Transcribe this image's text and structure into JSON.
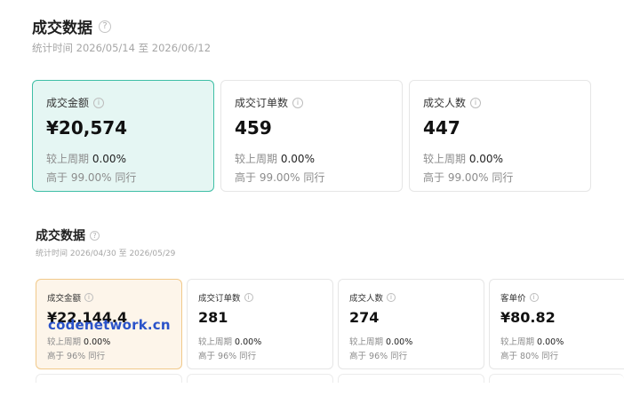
{
  "section1": {
    "title": "成交数据",
    "help_icon": "?",
    "subtitle": "统计时间 2026/05/14 至 2026/06/12",
    "cards": [
      {
        "label": "成交金额",
        "value": "¥20,574",
        "compare_label": "较上周期",
        "compare_value": "0.00%",
        "peer_text": "高于 99.00% 同行",
        "active": true
      },
      {
        "label": "成交订单数",
        "value": "459",
        "compare_label": "较上周期",
        "compare_value": "0.00%",
        "peer_text": "高于 99.00% 同行",
        "active": false
      },
      {
        "label": "成交人数",
        "value": "447",
        "compare_label": "较上周期",
        "compare_value": "0.00%",
        "peer_text": "高于 99.00% 同行",
        "active": false
      }
    ]
  },
  "section2": {
    "title": "成交数据",
    "help_icon": "?",
    "subtitle": "统计时间 2026/04/30 至 2026/05/29",
    "cards": [
      {
        "label": "成交金额",
        "value": "¥22,144.4",
        "compare_label": "较上周期",
        "compare_value": "0.00%",
        "peer_text": "高于 96% 同行",
        "active": true
      },
      {
        "label": "成交订单数",
        "value": "281",
        "compare_label": "较上周期",
        "compare_value": "0.00%",
        "peer_text": "高于 96% 同行",
        "active": false
      },
      {
        "label": "成交人数",
        "value": "274",
        "compare_label": "较上周期",
        "compare_value": "0.00%",
        "peer_text": "高于 96% 同行",
        "active": false
      },
      {
        "label": "客单价",
        "value": "¥80.82",
        "compare_label": "较上周期",
        "compare_value": "0.00%",
        "peer_text": "高于 80% 同行",
        "active": false
      }
    ]
  },
  "info_icon": "i",
  "watermark": "codenetwork.cn"
}
